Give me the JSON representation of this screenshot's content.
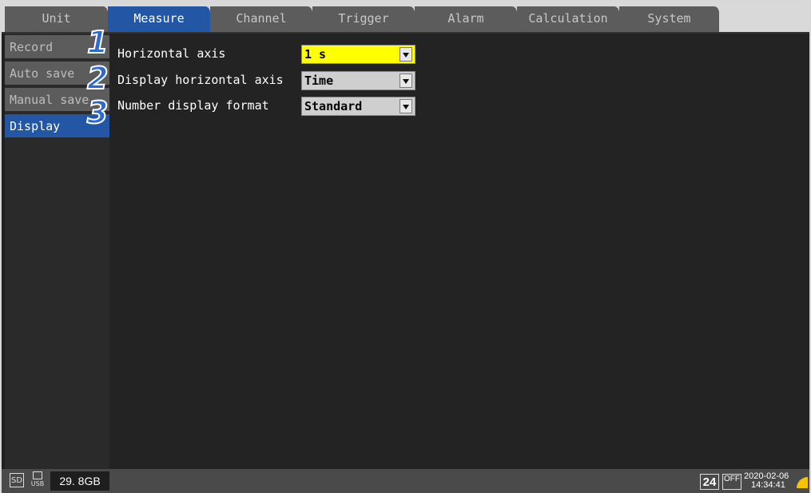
{
  "tabs": [
    {
      "label": "Unit",
      "active": false
    },
    {
      "label": "Measure",
      "active": true
    },
    {
      "label": "Channel",
      "active": false
    },
    {
      "label": "Trigger",
      "active": false
    },
    {
      "label": "Alarm",
      "active": false
    },
    {
      "label": "Calculation",
      "active": false
    },
    {
      "label": "System",
      "active": false
    }
  ],
  "sidebar": {
    "items": [
      {
        "label": "Record",
        "active": false
      },
      {
        "label": "Auto save",
        "active": false
      },
      {
        "label": "Manual save",
        "active": false
      },
      {
        "label": "Display",
        "active": true
      }
    ]
  },
  "settings": [
    {
      "number": "1",
      "label": "Horizontal axis",
      "value": "1 s",
      "highlight": true
    },
    {
      "number": "2",
      "label": "Display horizontal axis",
      "value": "Time",
      "highlight": false
    },
    {
      "number": "3",
      "label": "Number display format",
      "value": "Standard",
      "highlight": false
    }
  ],
  "status": {
    "sd_label": "SD",
    "usb_label": "USB",
    "storage": "29. 8GB",
    "clock_mode": "24",
    "sync_label": "OFF",
    "date": "2020-02-06",
    "time": "14:34:41"
  },
  "colors": {
    "accent": "#2456a6",
    "highlight": "#ffff00",
    "field": "#cfcfcf",
    "callout": "#2c6ad1"
  }
}
